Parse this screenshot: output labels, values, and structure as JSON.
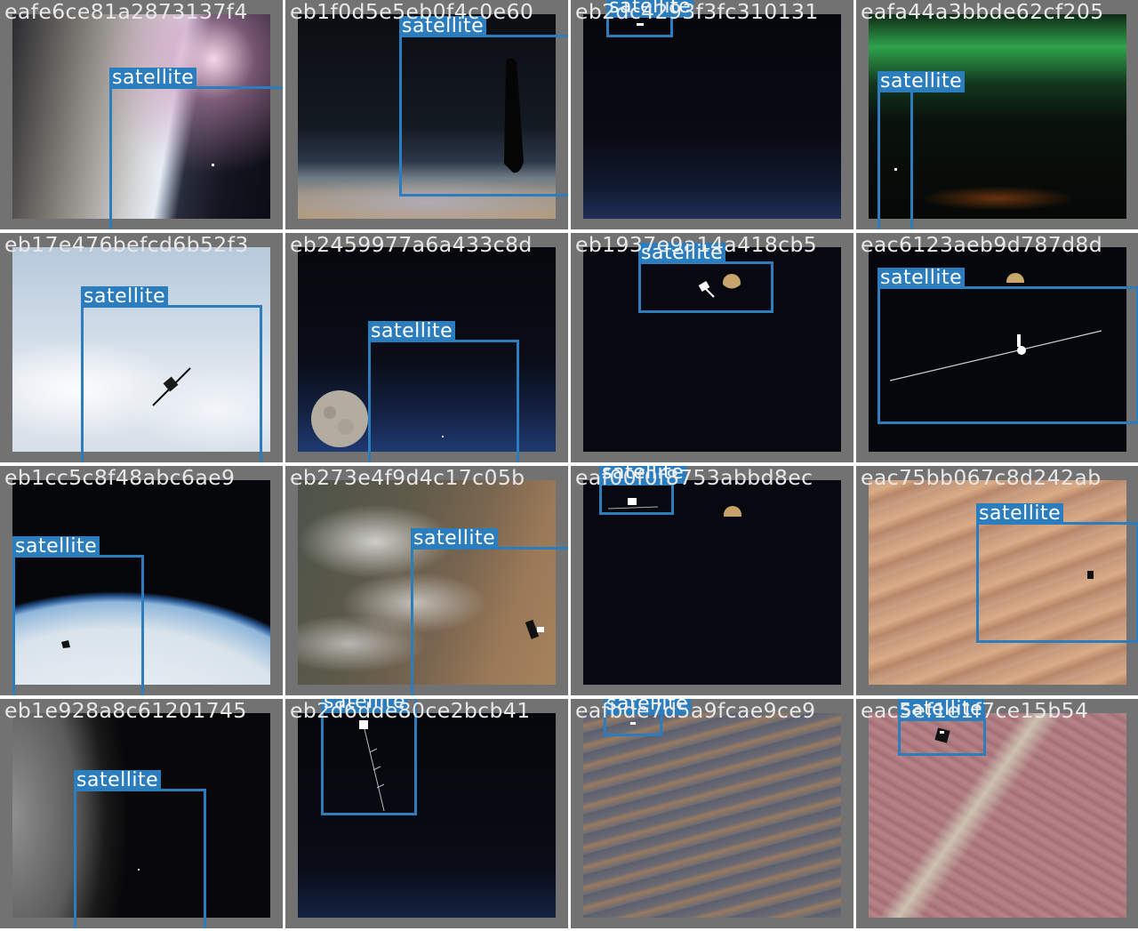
{
  "grid": {
    "box_color": "#2b7dbd",
    "label_color": "#ffffff",
    "id_color": "#e8e8e8",
    "cells": [
      {
        "id": "eafe6ce81a2873137f4",
        "label": "satellite",
        "scene": "earth-limb-sunrise"
      },
      {
        "id": "eb1f0d5e5eb0f4c0e60",
        "label": "satellite",
        "scene": "earth-horizon-dark-object"
      },
      {
        "id": "eb2dc4293f3fc310131",
        "label": "satellite",
        "scene": "deep-space-blue-horizon"
      },
      {
        "id": "eafa44a3bbde62cf205",
        "label": "satellite",
        "scene": "aurora-night-earth"
      },
      {
        "id": "eb17e476befcd6b52f3",
        "label": "satellite",
        "scene": "clouds-over-earth"
      },
      {
        "id": "eb2459977a6a433c8d",
        "label": "satellite",
        "scene": "moon-over-blue-horizon"
      },
      {
        "id": "eb1937e9a14a418cb5",
        "label": "satellite",
        "scene": "deep-space-with-moon"
      },
      {
        "id": "eac6123aeb9d787d8d",
        "label": "satellite",
        "scene": "deep-space-moon-satellite"
      },
      {
        "id": "eb1cc5c8f48abc6ae9",
        "label": "satellite",
        "scene": "earth-limb-white"
      },
      {
        "id": "eb273e4f9d4c17c05b",
        "label": "satellite",
        "scene": "snowy-mountains-desert"
      },
      {
        "id": "eaf00f0f8753abbd8ec",
        "label": "satellite",
        "scene": "deep-space-with-moon"
      },
      {
        "id": "eac75bb067c8d242ab",
        "label": "satellite",
        "scene": "desert-dunes"
      },
      {
        "id": "eb1e928a8c61201745",
        "label": "satellite",
        "scene": "lunar-surface"
      },
      {
        "id": "eb2d6dde80ce2bcb41",
        "label": "satellite",
        "scene": "dark-space-satellite"
      },
      {
        "id": "eafbde7d5a9fcae9ce9",
        "label": "satellite",
        "scene": "striped-desert"
      },
      {
        "id": "eac5ef1e1f7ce15b54",
        "label": "satellite",
        "scene": "pink-desert-river"
      }
    ]
  }
}
